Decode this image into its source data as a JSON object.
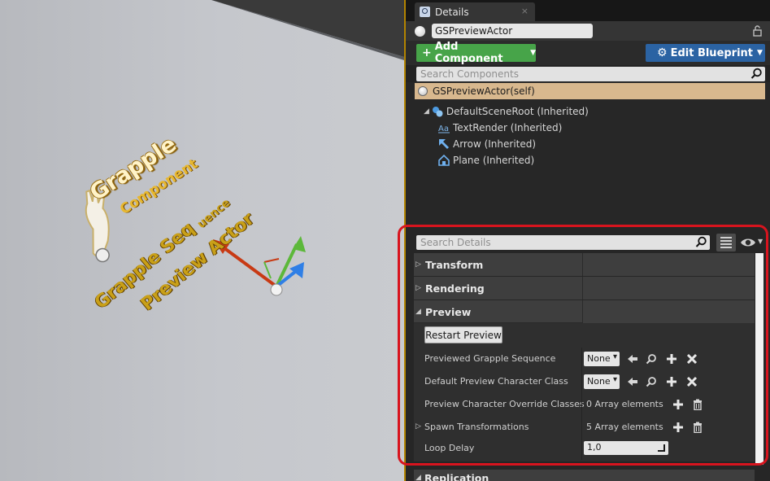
{
  "viewport": {
    "texts": {
      "grapple": "Grapple",
      "component": "Component",
      "sequence": "Grapple Seq",
      "sequence_tail": "uence",
      "preview_actor": "Preview Actor"
    }
  },
  "details_tab": {
    "label": "Details",
    "close": "×"
  },
  "actor": {
    "name": "GSPreviewActor"
  },
  "toolbar": {
    "add_component_label": "Add Component",
    "edit_blueprint_label": "Edit Blueprint"
  },
  "components_search": {
    "placeholder": "Search Components"
  },
  "tree": {
    "self_label": "GSPreviewActor(self)",
    "items": [
      {
        "label": "DefaultSceneRoot (Inherited)",
        "icon": "scene-root-icon"
      },
      {
        "label": "TextRender (Inherited)",
        "icon": "text-render-icon"
      },
      {
        "label": "Arrow (Inherited)",
        "icon": "arrow-component-icon"
      },
      {
        "label": "Plane (Inherited)",
        "icon": "static-mesh-icon"
      }
    ]
  },
  "details_search": {
    "placeholder": "Search Details"
  },
  "categories": {
    "transform": "Transform",
    "rendering": "Rendering",
    "preview": "Preview",
    "replication": "Replication"
  },
  "preview": {
    "restart_label": "Restart Preview",
    "props": [
      {
        "name": "Previewed Grapple Sequence",
        "value": "None"
      },
      {
        "name": "Default Preview Character Class",
        "value": "None"
      },
      {
        "name": "Preview Character Override Classes",
        "value": "0 Array elements"
      },
      {
        "name": "Spawn Transformations",
        "value": "5 Array elements"
      },
      {
        "name": "Loop Delay",
        "value": "1,0"
      }
    ]
  },
  "colors": {
    "add_component": "#47a449",
    "edit_blueprint": "#2b63a3",
    "selection": "#d8b88e",
    "highlight": "#d8141e"
  }
}
